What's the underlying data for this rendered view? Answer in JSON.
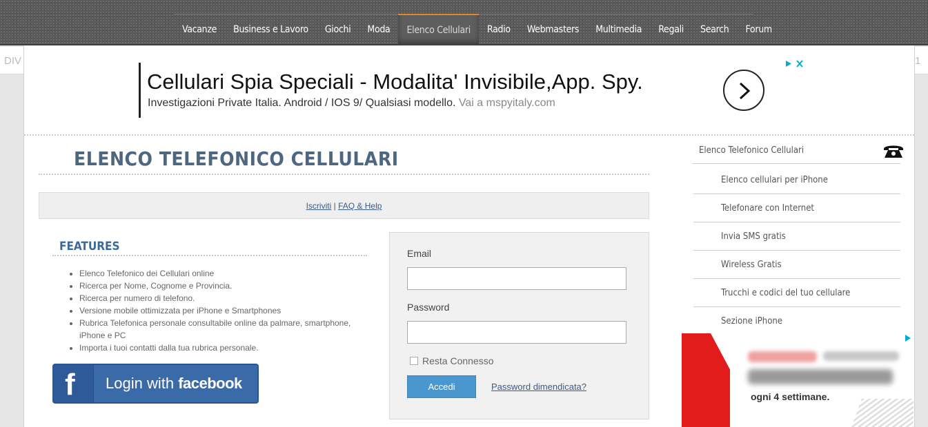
{
  "nav": {
    "items": [
      {
        "label": "Vacanze",
        "active": false
      },
      {
        "label": "Business e Lavoro",
        "active": false
      },
      {
        "label": "Giochi",
        "active": false
      },
      {
        "label": "Moda",
        "active": false
      },
      {
        "label": "Elenco Cellulari",
        "active": true
      },
      {
        "label": "Radio",
        "active": false
      },
      {
        "label": "Webmasters",
        "active": false
      },
      {
        "label": "Multimedia",
        "active": false
      },
      {
        "label": "Regali",
        "active": false
      },
      {
        "label": "Search",
        "active": false
      },
      {
        "label": "Forum",
        "active": false
      }
    ],
    "active_color": "#e08a2c"
  },
  "edge": {
    "left_text": "DIV",
    "right_text": "1"
  },
  "ad": {
    "headline": "Cellulari Spia Speciali - Modalita' Invisibile,App. Spy.",
    "description": "Investigazioni Private Italia. Android / IOS 9/ Qualsiasi modello.",
    "url": "Vai a mspyitaly.com",
    "adchoices_icon": "adchoices-icon",
    "close_icon": "close-icon",
    "arrow_icon": "chevron-right-icon"
  },
  "main": {
    "title": "ELENCO TELEFONICO CELLULARI",
    "links": {
      "signup": "Iscriviti",
      "separator": "|",
      "faq": "FAQ & Help"
    },
    "features": {
      "title": "FEATURES",
      "items": [
        "Elenco Telefonico dei Cellulari online",
        "Ricerca per Nome, Cognome e Provincia.",
        "Ricerca per numero di telefono.",
        "Versione mobile ottimizzata per iPhone e Smartphones",
        "Rubrica Telefonica personale consultabile online da palmare, smartphone, iPhone e PC",
        "Importa i tuoi contatti dalla tua rubrica personale."
      ]
    },
    "facebook": {
      "icon_letter": "f",
      "prefix": "Login with",
      "brand": "facebook",
      "color": "#3b6aa8"
    }
  },
  "login": {
    "email_label": "Email",
    "email_value": "",
    "password_label": "Password",
    "password_value": "",
    "remember_label": "Resta Connesso",
    "remember_checked": false,
    "submit_label": "Accedi",
    "forgot_label": "Password dimendicata?",
    "button_color": "#4a97d0"
  },
  "sidebar": {
    "header": "Elenco Telefonico Cellulari",
    "header_icon": "telephone-icon",
    "items": [
      "Elenco cellulari per iPhone",
      "Telefonare con Internet",
      "Invia SMS gratis",
      "Wireless Gratis",
      "Trucchi e codici del tuo cellulare",
      "Sezione iPhone"
    ]
  },
  "ad2": {
    "visible_text": "ogni 4 settimane.",
    "brand_color": "#e21b1b"
  }
}
